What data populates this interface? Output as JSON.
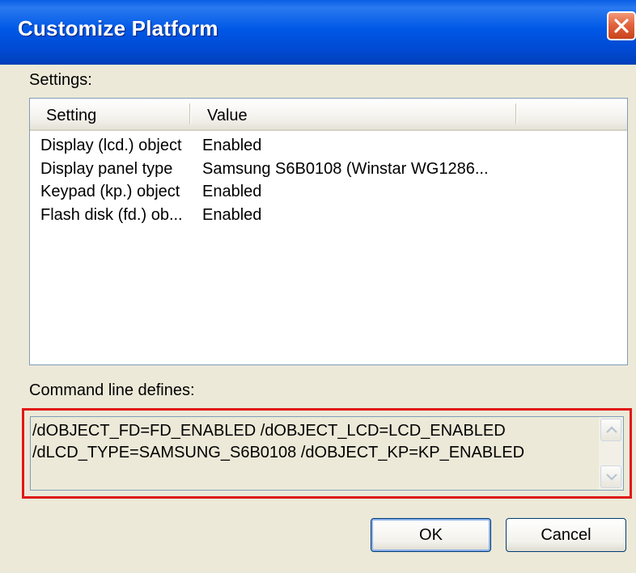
{
  "window": {
    "title": "Customize Platform",
    "close_icon": "close-x-icon"
  },
  "settings": {
    "label": "Settings:",
    "columns": [
      "Setting",
      "Value"
    ],
    "rows": [
      {
        "setting": "Display (lcd.) object",
        "value": "Enabled"
      },
      {
        "setting": "Display panel type",
        "value": "Samsung S6B0108 (Winstar WG1286..."
      },
      {
        "setting": "Keypad (kp.) object",
        "value": "Enabled"
      },
      {
        "setting": "Flash disk (fd.) ob...",
        "value": "Enabled"
      }
    ]
  },
  "command_line": {
    "label": "Command line defines:",
    "lines": [
      "/dOBJECT_FD=FD_ENABLED /dOBJECT_LCD=LCD_ENABLED",
      "/dLCD_TYPE=SAMSUNG_S6B0108 /dOBJECT_KP=KP_ENABLED"
    ],
    "highlight_color": "#e01818"
  },
  "buttons": {
    "ok": "OK",
    "cancel": "Cancel"
  }
}
